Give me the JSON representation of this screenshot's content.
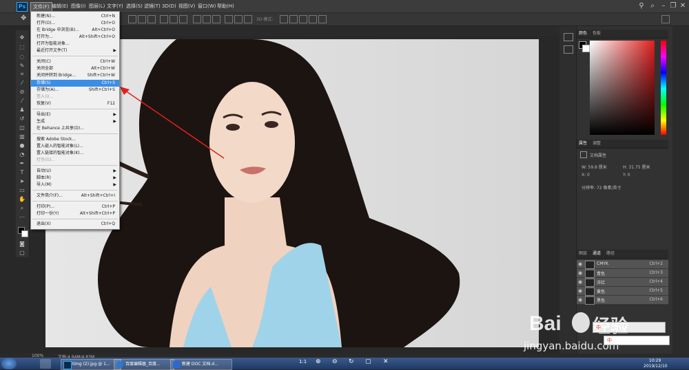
{
  "menubar": {
    "logo": "Ps",
    "items": [
      "文件(F)",
      "编辑(E)",
      "图像(I)",
      "图层(L)",
      "文字(Y)",
      "选择(S)",
      "滤镜(T)",
      "3D(D)",
      "视图(V)",
      "窗口(W)",
      "帮助(H)"
    ]
  },
  "options_bar": {
    "mode_3d": "3D 模式:"
  },
  "file_menu": {
    "items": [
      {
        "label": "新建(N)...",
        "shortcut": "Ctrl+N"
      },
      {
        "label": "打开(O)...",
        "shortcut": "Ctrl+O"
      },
      {
        "label": "在 Bridge 中浏览(B)...",
        "shortcut": "Alt+Ctrl+O"
      },
      {
        "label": "打开为...",
        "shortcut": "Alt+Shift+Ctrl+O"
      },
      {
        "label": "打开为智能对象...",
        "shortcut": ""
      },
      {
        "label": "最近打开文件(T)",
        "shortcut": ""
      },
      {
        "label": "关闭(C)",
        "shortcut": "Ctrl+W"
      },
      {
        "label": "关闭全部",
        "shortcut": "Alt+Ctrl+W"
      },
      {
        "label": "关闭并转到 Bridge...",
        "shortcut": "Shift+Ctrl+W"
      },
      {
        "label": "存储(S)",
        "shortcut": "Ctrl+S"
      },
      {
        "label": "存储为(A)...",
        "shortcut": "Shift+Ctrl+S"
      },
      {
        "label": "签入(I)...",
        "shortcut": ""
      },
      {
        "label": "恢复(V)",
        "shortcut": "F12"
      },
      {
        "label": "导出(E)",
        "shortcut": ""
      },
      {
        "label": "生成",
        "shortcut": ""
      },
      {
        "label": "在 Behance 上共享(D)...",
        "shortcut": ""
      },
      {
        "label": "搜索 Adobe Stock...",
        "shortcut": ""
      },
      {
        "label": "置入嵌入的智能对象(L)...",
        "shortcut": ""
      },
      {
        "label": "置入链接的智能对象(K)...",
        "shortcut": ""
      },
      {
        "label": "打包(G)...",
        "shortcut": ""
      },
      {
        "label": "自动(U)",
        "shortcut": ""
      },
      {
        "label": "脚本(R)",
        "shortcut": ""
      },
      {
        "label": "导入(M)",
        "shortcut": ""
      },
      {
        "label": "文件简介(F)...",
        "shortcut": "Alt+Shift+Ctrl+I"
      },
      {
        "label": "打印(P)...",
        "shortcut": "Ctrl+P"
      },
      {
        "label": "打印一份(Y)",
        "shortcut": "Alt+Shift+Ctrl+P"
      },
      {
        "label": "退出(X)",
        "shortcut": "Ctrl+Q"
      }
    ]
  },
  "color_panel": {
    "tabs": [
      "颜色",
      "色板"
    ]
  },
  "properties_panel": {
    "tabs": [
      "属性",
      "调整"
    ],
    "title": "文档属性",
    "w": "W: 59.8 厘米",
    "h": "H: 31.75 厘米",
    "x": "X: 0",
    "y": "Y: 0",
    "resolution": "分辨率: 72 像素/英寸"
  },
  "channels_panel": {
    "tabs": [
      "图层",
      "通道",
      "路径"
    ],
    "rows": [
      {
        "name": "CMYK",
        "key": "Ctrl+2"
      },
      {
        "name": "青色",
        "key": "Ctrl+3"
      },
      {
        "name": "洋红",
        "key": "Ctrl+4"
      },
      {
        "name": "黄色",
        "key": "Ctrl+5"
      },
      {
        "name": "黑色",
        "key": "Ctrl+6"
      }
    ]
  },
  "status": {
    "zoom": "100%",
    "doc": "文档:4.94M/4.83M"
  },
  "taskbar": {
    "items": [
      "timg (2).jpg @ 1...",
      "百度编辑器_百度...",
      "新建 DOC 文档.d..."
    ],
    "viewer_ratio": "1:1",
    "time": "10:29",
    "date": "2019/12/10"
  },
  "watermark": {
    "brand": "Bai",
    "brand2": "经验",
    "url": "jingyan.baidu.com",
    "ime": "中"
  },
  "colors": {
    "highlight": "#3a8ee6",
    "arrow": "#e02020",
    "dress": "#9fd3ea"
  }
}
